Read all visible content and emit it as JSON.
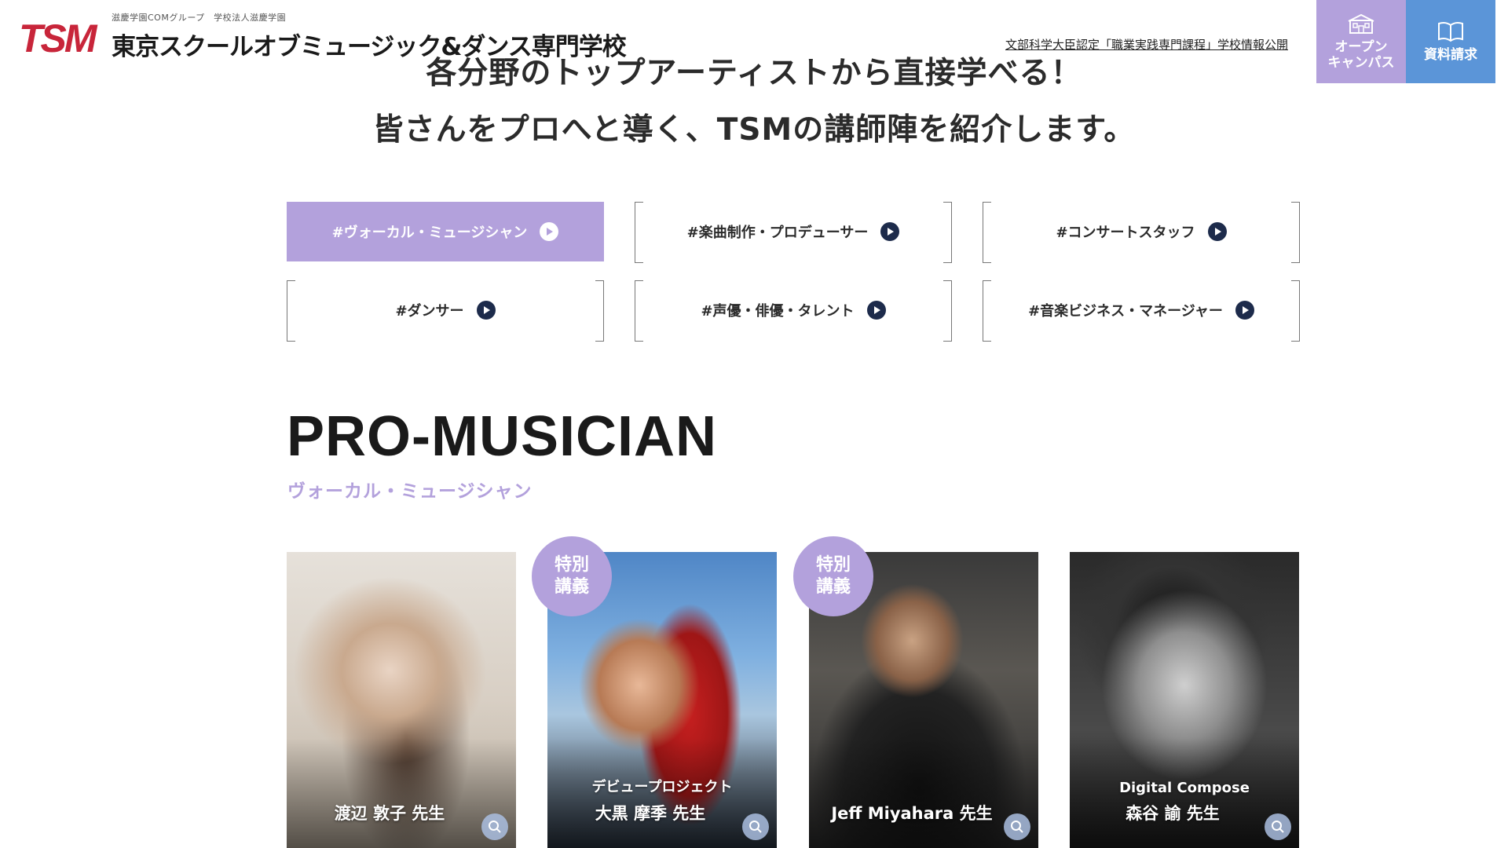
{
  "header": {
    "logo_mark": "TSM",
    "logo_sub": "滋慶学園COMグループ　学校法人滋慶学園",
    "logo_main": "東京スクールオブミュージック&ダンス専門学校",
    "info_link": "文部科学大臣認定「職業実践専門課程」学校情報公開",
    "open_campus_label": "オープン\nキャンパス",
    "request_docs_label": "資料請求",
    "accent_purple": "#b3a1dc",
    "accent_blue": "#5b95d8"
  },
  "lead": {
    "line1": "各分野のトップアーティストから直接学べる！",
    "line2": "皆さんをプロへと導く、TSMの講師陣を紹介します。"
  },
  "categories": [
    {
      "label": "#ヴォーカル・ミュージシャン",
      "active": true
    },
    {
      "label": "#楽曲制作・プロデューサー",
      "active": false
    },
    {
      "label": "#コンサートスタッフ",
      "active": false
    },
    {
      "label": "#ダンサー",
      "active": false
    },
    {
      "label": "#声優・俳優・タレント",
      "active": false
    },
    {
      "label": "#音楽ビジネス・マネージャー",
      "active": false
    }
  ],
  "section": {
    "title": "PRO-MUSICIAN",
    "subtitle": "ヴォーカル・ミュージシャン"
  },
  "instructors": [
    {
      "tag": "",
      "name": "渡辺 敦子 先生",
      "badge": ""
    },
    {
      "tag": "デビュープロジェクト",
      "name": "大黒 摩季 先生",
      "badge": "特別\n講義"
    },
    {
      "tag": "",
      "name": "Jeff Miyahara 先生",
      "badge": "特別\n講義"
    },
    {
      "tag": "Digital Compose",
      "name": "森谷 諭 先生",
      "badge": ""
    }
  ]
}
